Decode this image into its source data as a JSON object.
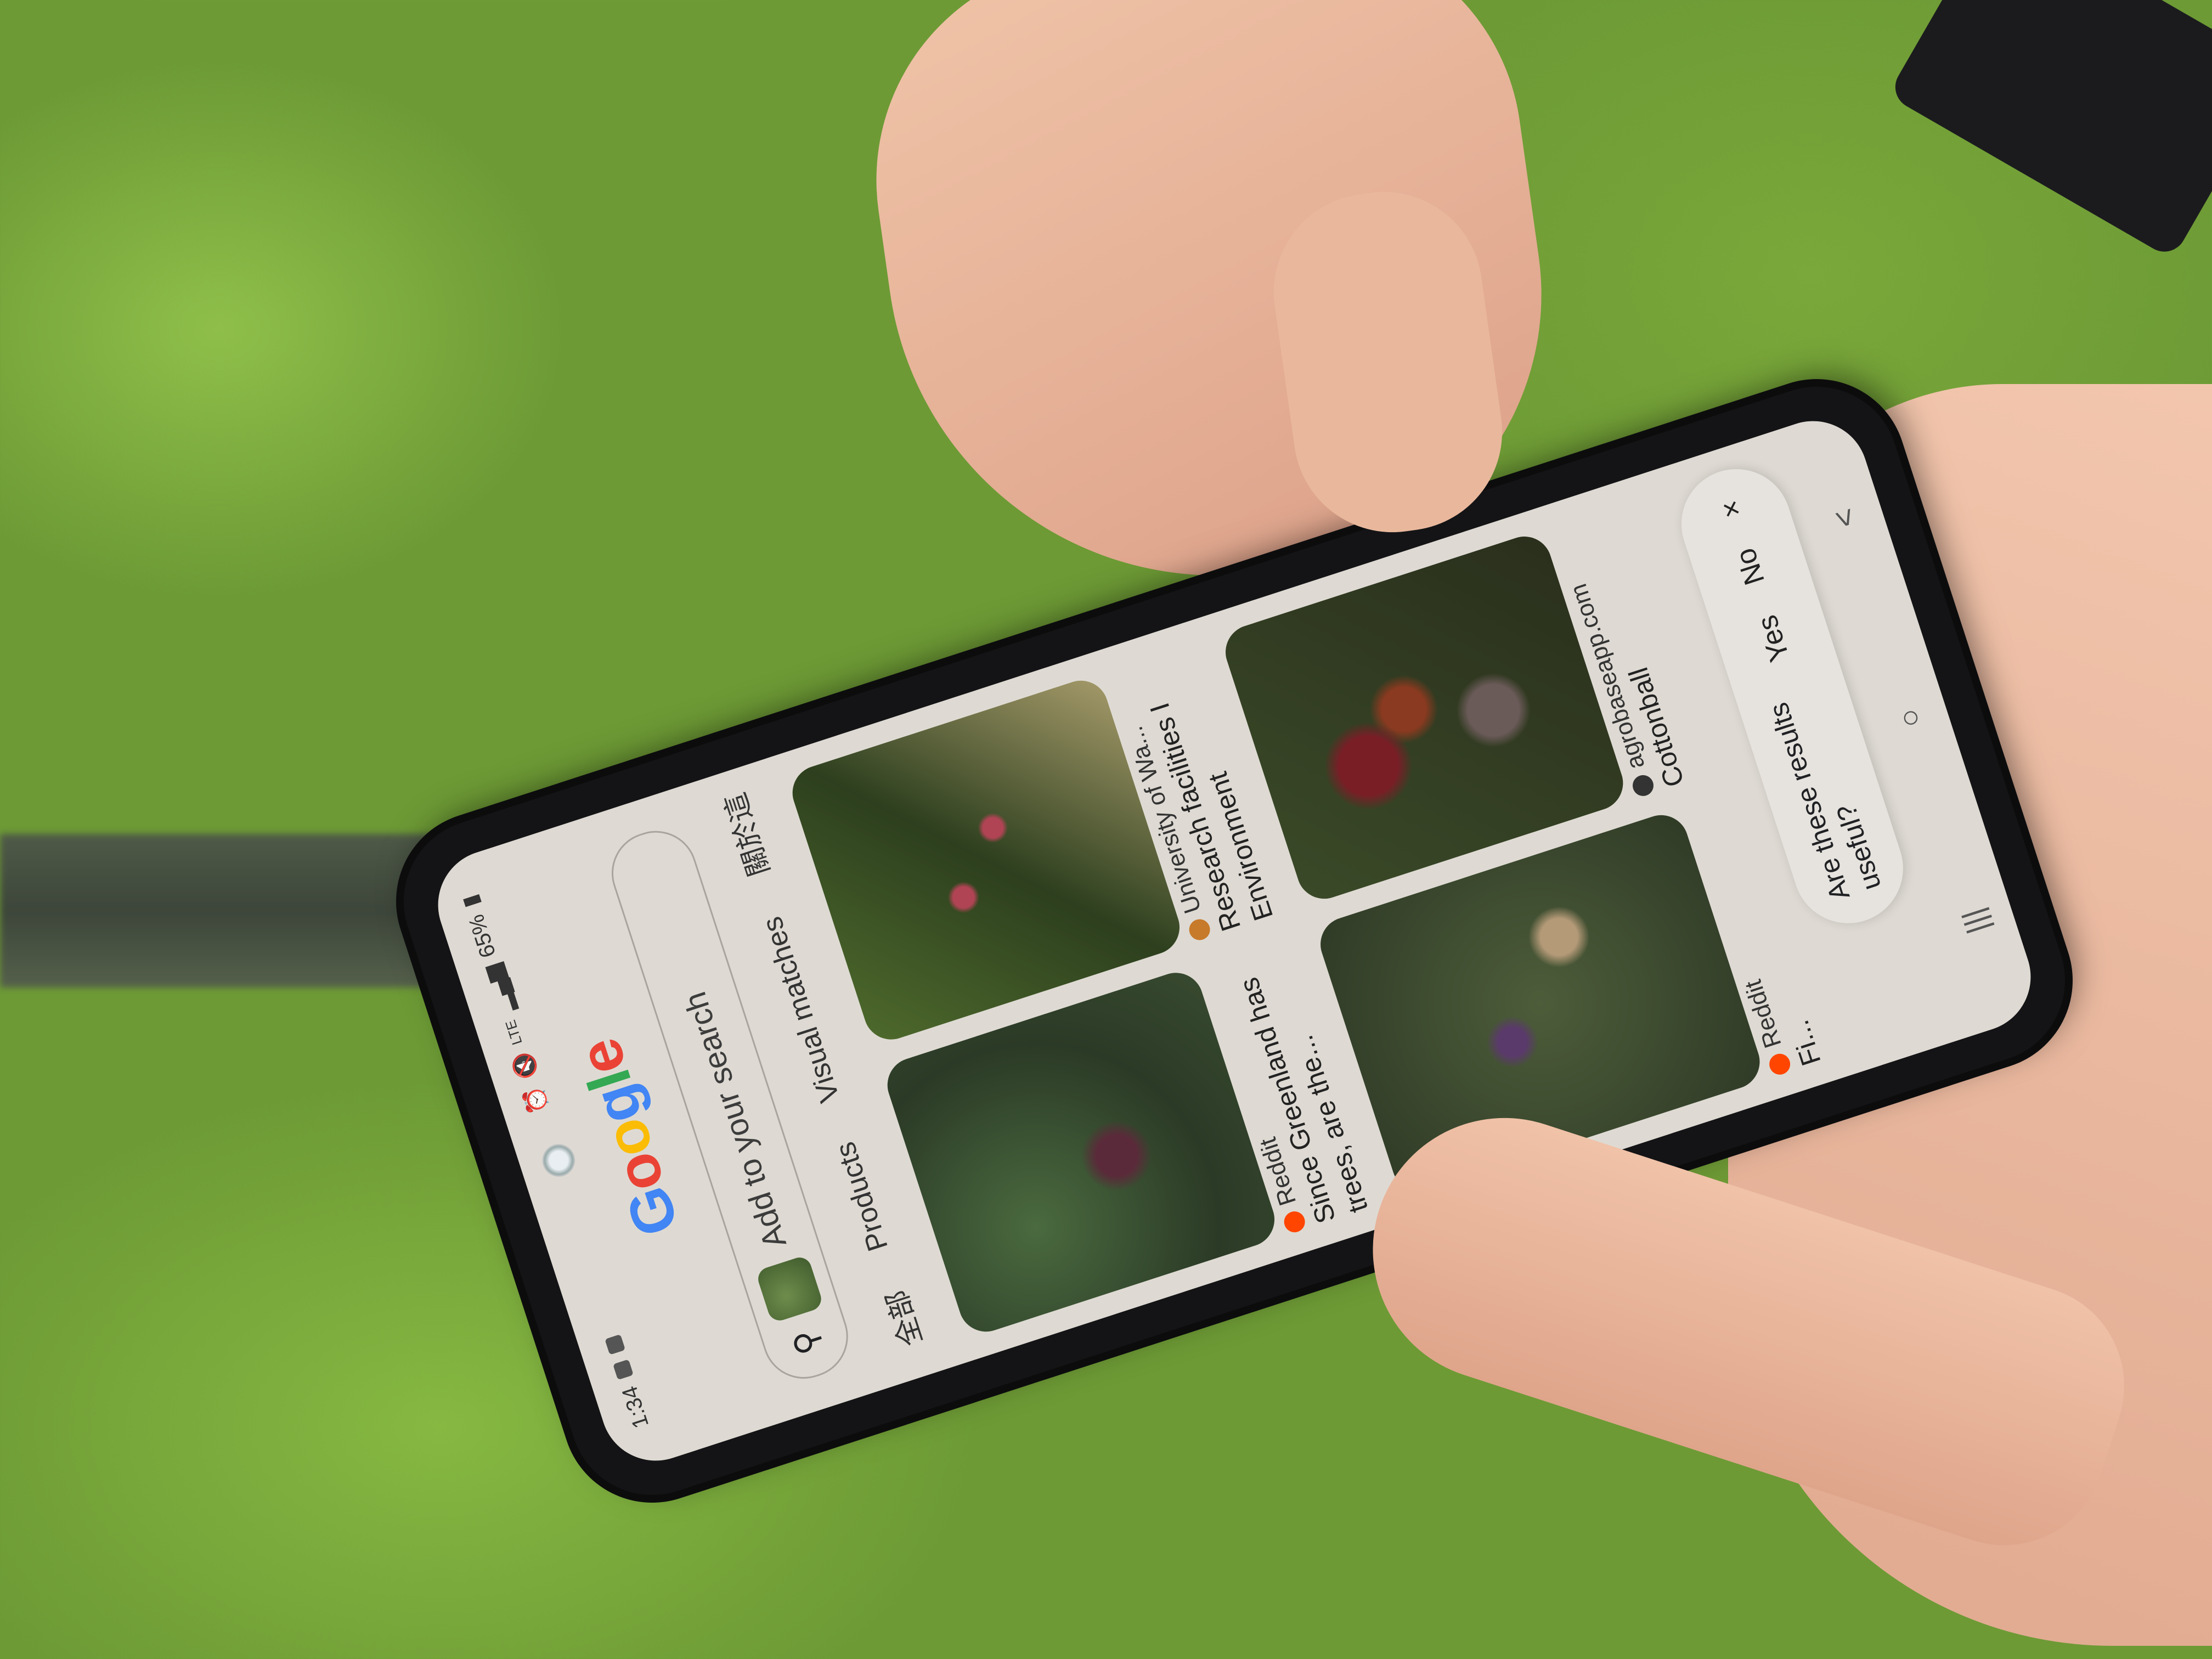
{
  "status_bar": {
    "time": "1:34",
    "network": "LTE",
    "battery": "65%"
  },
  "header": {
    "logo": [
      "G",
      "o",
      "o",
      "g",
      "l",
      "e"
    ]
  },
  "search": {
    "placeholder": "Add to your search",
    "icon": "search-icon"
  },
  "tabs": [
    {
      "label": "全部"
    },
    {
      "label": "Products"
    },
    {
      "label": "Visual matches"
    },
    {
      "label": "關於這"
    }
  ],
  "results": {
    "left": [
      {
        "source": "Reddit",
        "title": "Since Greenland has trees, are the..."
      },
      {
        "source": "Reddit",
        "title": "Fi..."
      }
    ],
    "right": [
      {
        "source": "University of Wa...",
        "title": "Research facilities I Environment"
      },
      {
        "source": "agrobaseapp.com",
        "title": "Cottonball"
      }
    ]
  },
  "feedback": {
    "question": "Are these results useful?",
    "yes": "Yes",
    "no": "No",
    "close": "×"
  },
  "nav": {
    "recents": "|||",
    "home": "○",
    "back": "<"
  },
  "colors": {
    "reddit": "#ff4500",
    "screen_bg": "#dedad3"
  }
}
